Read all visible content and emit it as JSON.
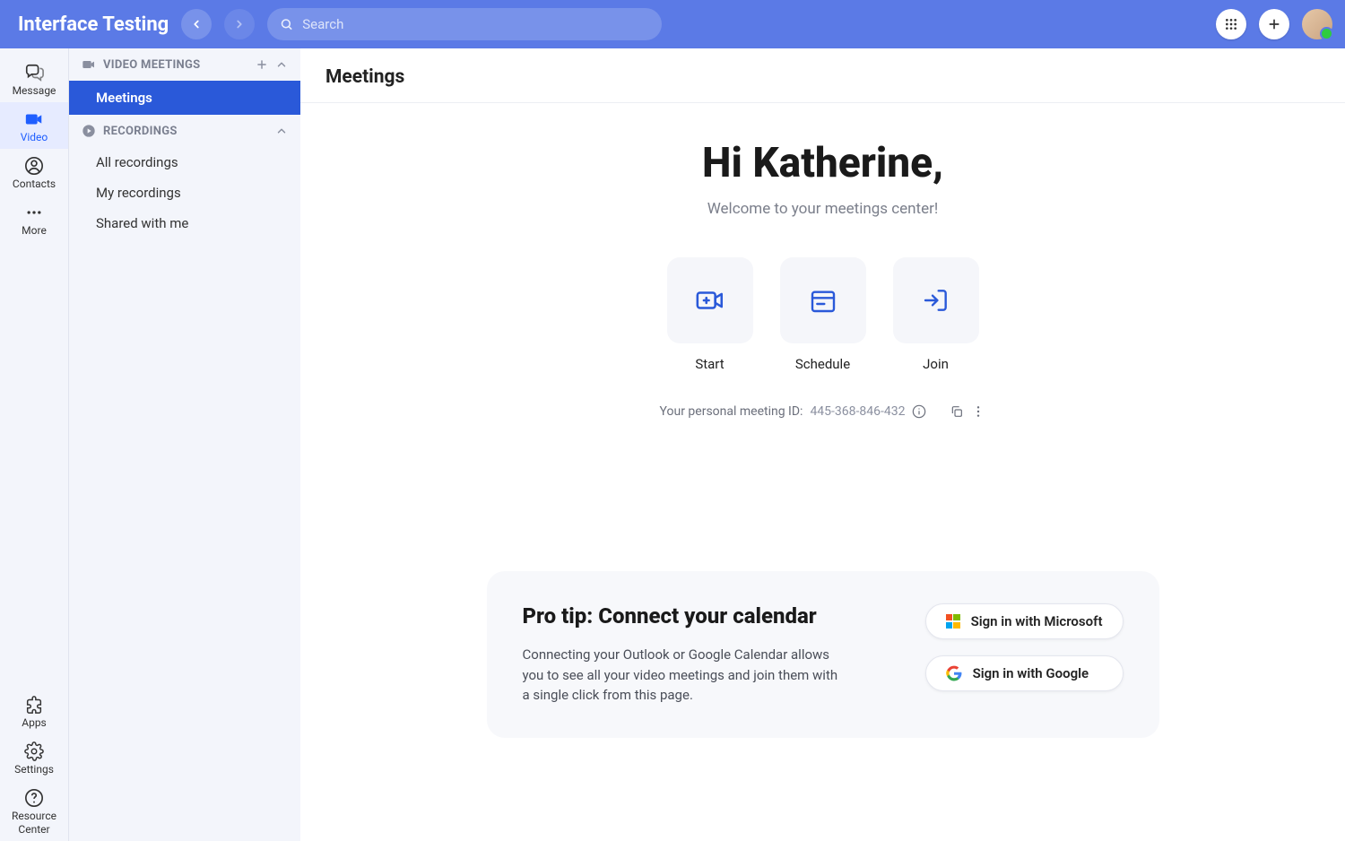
{
  "header": {
    "app_title": "Interface Testing",
    "search_placeholder": "Search"
  },
  "rail": {
    "items": [
      {
        "label": "Message"
      },
      {
        "label": "Video"
      },
      {
        "label": "Contacts"
      },
      {
        "label": "More"
      }
    ],
    "bottom_items": [
      {
        "label": "Apps"
      },
      {
        "label": "Settings"
      },
      {
        "label": "Resource Center"
      }
    ],
    "active_index": 1
  },
  "sidebar": {
    "sections": [
      {
        "title": "VIDEO MEETINGS",
        "items": [
          {
            "label": "Meetings",
            "active": true
          }
        ]
      },
      {
        "title": "RECORDINGS",
        "items": [
          {
            "label": "All recordings"
          },
          {
            "label": "My recordings"
          },
          {
            "label": "Shared with me"
          }
        ]
      }
    ]
  },
  "main": {
    "title": "Meetings",
    "greeting": "Hi Katherine,",
    "subgreeting": "Welcome to your meetings center!",
    "actions": [
      {
        "label": "Start"
      },
      {
        "label": "Schedule"
      },
      {
        "label": "Join"
      }
    ],
    "pmi_label": "Your personal meeting ID:",
    "pmi_value": "445-368-846-432"
  },
  "protip": {
    "heading": "Pro tip: Connect your calendar",
    "body": "Connecting your Outlook or Google Calendar allows you to see all your video meetings and join them with a single click from this page.",
    "ms_button": "Sign in with Microsoft",
    "google_button": "Sign in with Google"
  }
}
